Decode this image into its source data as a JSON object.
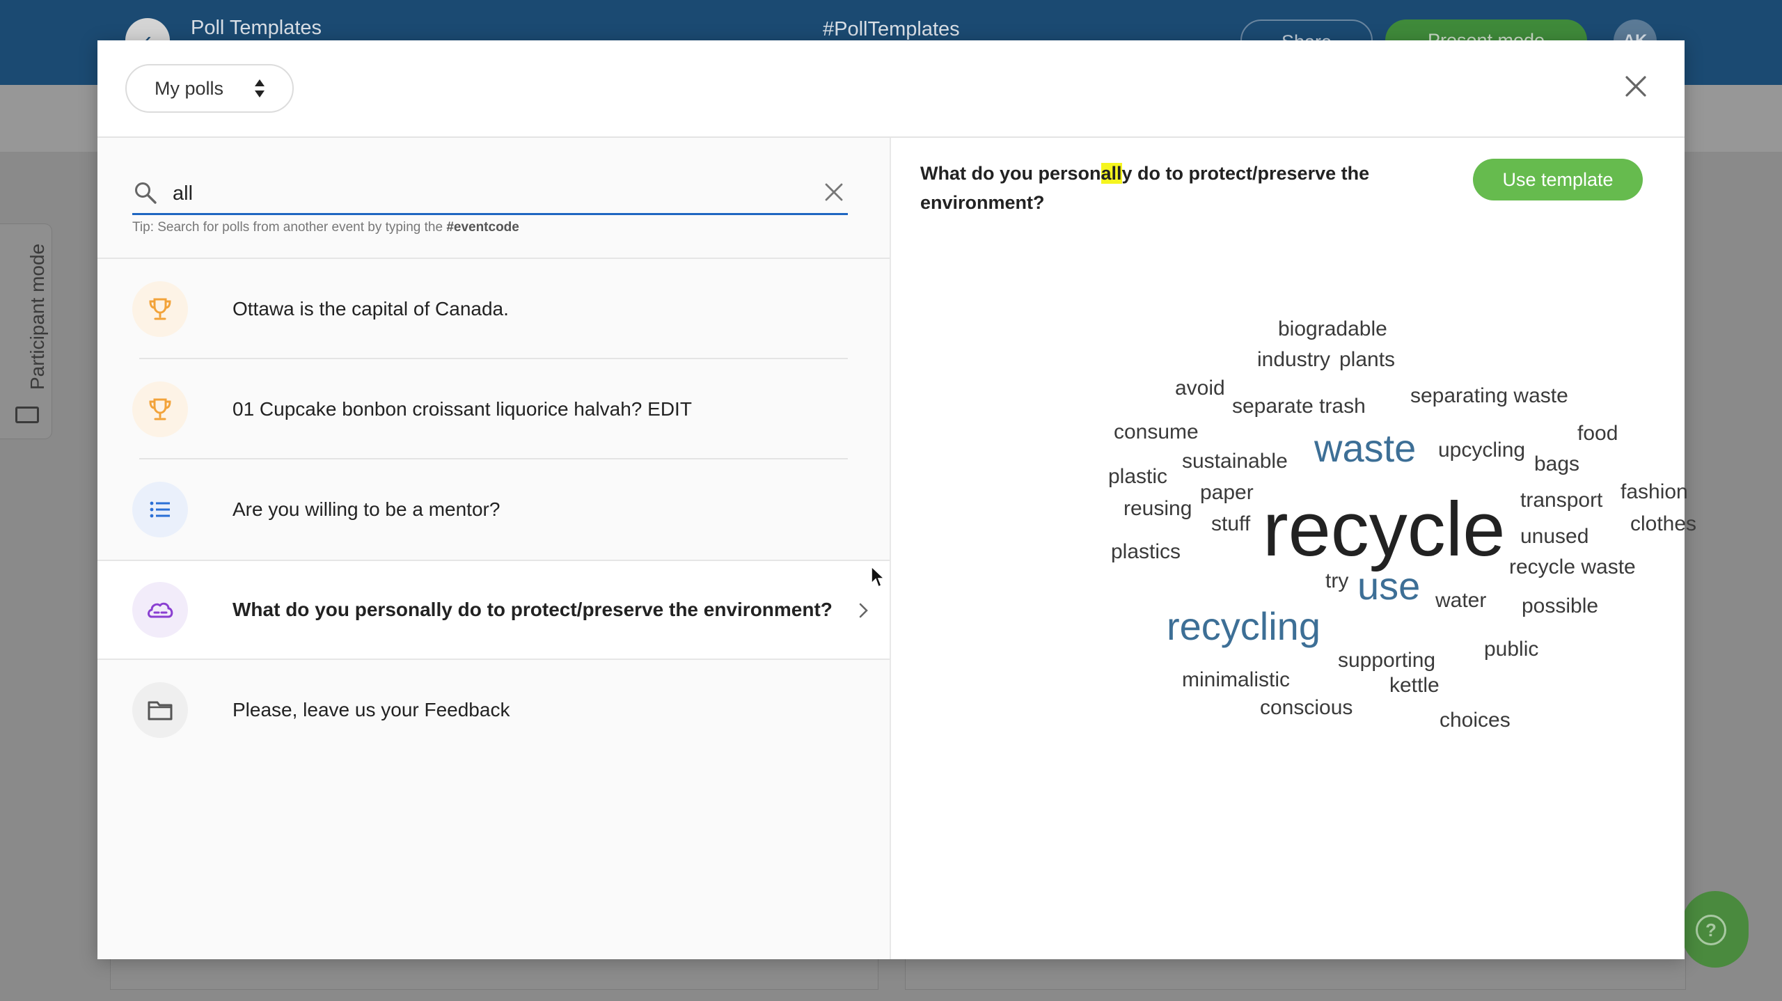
{
  "background_app": {
    "title": "Poll Templates",
    "event_code": "#PollTemplates",
    "share_label": "Share",
    "present_label": "Present mode",
    "avatar_initials": "AK",
    "participant_mode_label": "Participant mode"
  },
  "modal": {
    "scope_select": "My polls",
    "search": {
      "value": "all",
      "placeholder": ""
    },
    "tip_prefix": "Tip: Search for polls from another event by typing the ",
    "tip_code": "#eventcode",
    "polls": [
      {
        "icon": "trophy-icon",
        "title": "Ottawa is the capital of Canada."
      },
      {
        "icon": "trophy-icon",
        "title": "01 Cupcake bonbon croissant liquorice halvah? EDIT"
      },
      {
        "icon": "list-icon",
        "title": "Are you willing to be a mentor?"
      },
      {
        "icon": "word-cloud-icon",
        "title": "What do you personally do to protect/preserve the environment?",
        "selected": true
      },
      {
        "icon": "folder-icon",
        "title": "Please, leave us your Feedback"
      }
    ],
    "preview": {
      "question_before": "What do you person",
      "question_highlight": "all",
      "question_after": "y do to protect/preserve the environment?",
      "use_template_label": "Use template",
      "words": [
        "biogradable",
        "industry",
        "plants",
        "avoid",
        "separate trash",
        "separating waste",
        "consume",
        "food",
        "waste",
        "upcycling",
        "bags",
        "plastic",
        "sustainable",
        "paper",
        "reusing",
        "transport",
        "fashion",
        "stuff",
        "recycle",
        "unused",
        "clothes",
        "plastics",
        "recycle waste",
        "try",
        "use",
        "water",
        "possible",
        "recycling",
        "supporting",
        "public",
        "minimalistic",
        "kettle",
        "conscious",
        "choices"
      ]
    }
  },
  "colors": {
    "header": "#1b4a72",
    "accent_blue": "#1f66c1",
    "green": "#66bb4e",
    "trophy": "#f2a33a",
    "list": "#2a6fd6",
    "cloud": "#8a3fd1",
    "word_blue": "#3d6f96"
  }
}
